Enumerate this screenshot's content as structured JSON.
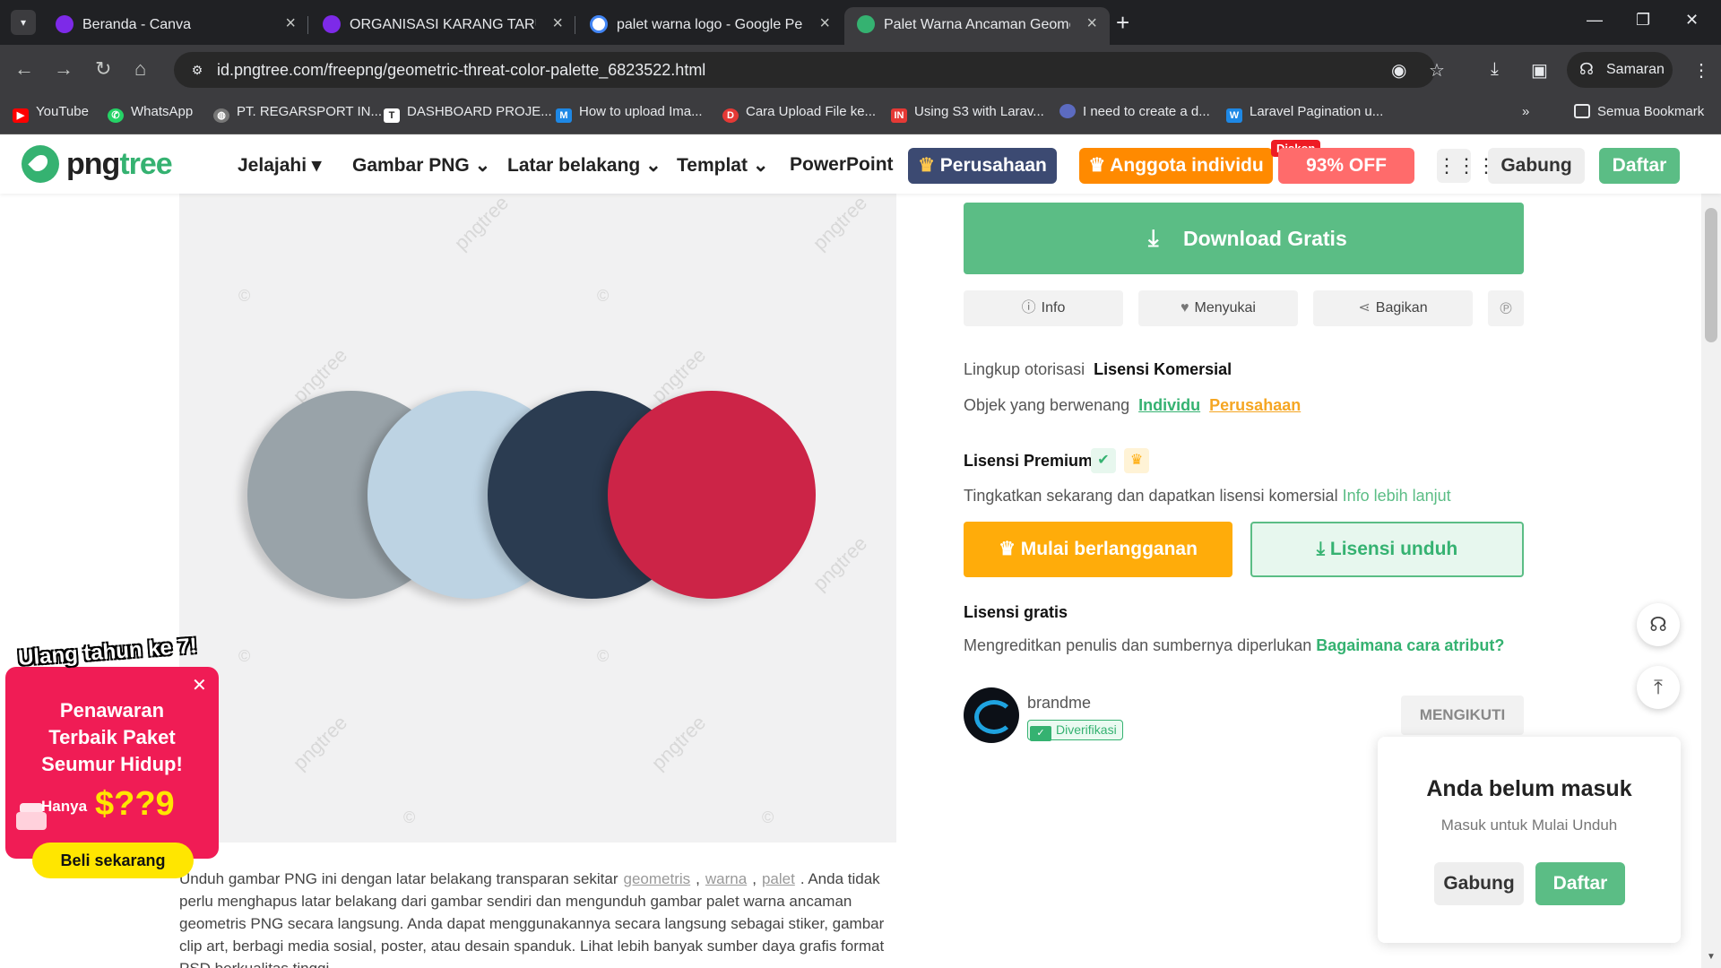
{
  "browser": {
    "tabs": [
      {
        "title": "Beranda - Canva",
        "favicon": "canva-icon",
        "active": false
      },
      {
        "title": "ORGANISASI KARANG TARUNA",
        "favicon": "canva-icon",
        "active": false
      },
      {
        "title": "palet warna logo - Google Penelusuran",
        "favicon": "google-icon",
        "active": false
      },
      {
        "title": "Palet Warna Ancaman Geometris",
        "favicon": "pngtree-icon",
        "active": true
      }
    ],
    "url": "id.pngtree.com/freepng/geometric-threat-color-palette_6823522.html",
    "profile_label": "Samaran",
    "bookmarks": [
      {
        "label": "YouTube",
        "icon": "youtube-icon",
        "color": "#ff0000"
      },
      {
        "label": "WhatsApp",
        "icon": "whatsapp-icon",
        "color": "#25d366"
      },
      {
        "label": "PT. REGARSPORT IN...",
        "icon": "globe-icon",
        "color": "#888888"
      },
      {
        "label": "DASHBOARD PROJE...",
        "icon": "tableau-icon",
        "color": "#ffffff"
      },
      {
        "label": "How to upload Ima...",
        "icon": "medium-icon",
        "color": "#1e88e5"
      },
      {
        "label": "Cara Upload File ke...",
        "icon": "dw-icon",
        "color": "#e53935"
      },
      {
        "label": "Using S3 with Larav...",
        "icon": "in-icon",
        "color": "#e53935"
      },
      {
        "label": "I need to create a d...",
        "icon": "circle-icon",
        "color": "#5c6bc0"
      },
      {
        "label": "Laravel Pagination u...",
        "icon": "w-icon",
        "color": "#1e88e5"
      }
    ],
    "all_bookmarks": "Semua Bookmark"
  },
  "header": {
    "logo_text_a": "png",
    "logo_text_b": "tree",
    "nav": [
      "Jelajahi",
      "Gambar PNG",
      "Latar belakang",
      "Templat",
      "PowerPoint"
    ],
    "perusahaan": "Perusahaan",
    "anggota": "Anggota individu",
    "diskon": "Diskon",
    "off": "93% OFF",
    "gabung": "Gabung",
    "daftar": "Daftar"
  },
  "preview": {
    "palette": [
      "#99a3a9",
      "#bdd3e3",
      "#2b3c51",
      "#cc2447"
    ],
    "watermark": "pngtree"
  },
  "sidebar": {
    "download": "Download Gratis",
    "info": "Info",
    "like": "Menyukai",
    "share": "Bagikan",
    "lingkup_label": "Lingkup otorisasi",
    "lingkup_value": "Lisensi Komersial",
    "objek_label": "Objek yang berwenang",
    "objek_individu": "Individu",
    "objek_perusahaan": "Perusahaan",
    "premium_title": "Lisensi Premium",
    "premium_desc": "Tingkatkan sekarang dan dapatkan lisensi komersial",
    "premium_link": "Info lebih lanjut",
    "subscribe": "Mulai berlangganan",
    "license_download": "Lisensi unduh",
    "free_title": "Lisensi gratis",
    "free_desc": "Mengreditkan penulis dan sumbernya diperlukan",
    "free_link": "Bagaimana cara atribut?",
    "author": "brandme",
    "verified": "Diverifikasi",
    "follow": "MENGIKUTI"
  },
  "description": {
    "prefix": "Unduh gambar PNG ini dengan latar belakang transparan sekitar",
    "tags": [
      "geometris",
      "warna",
      "palet"
    ],
    "body": ". Anda tidak perlu menghapus latar belakang dari gambar sendiri dan mengunduh gambar palet warna ancaman geometris PNG secara langsung. Anda dapat menggunakannya secara langsung sebagai stiker, gambar clip art, berbagi media sosial, poster, atau desain spanduk. Lihat lebih banyak sumber daya grafis format PSD berkualitas tinggi."
  },
  "login_box": {
    "title": "Anda belum masuk",
    "subtitle": "Masuk untuk Mulai Unduh",
    "gabung": "Gabung",
    "daftar": "Daftar"
  },
  "promo": {
    "banner": "Ulang tahun ke 7!",
    "line1": "Penawaran",
    "line2": "Terbaik Paket",
    "line3": "Seumur Hidup!",
    "hanya": "Hanya",
    "price": "$??9",
    "buy": "Beli sekarang"
  }
}
